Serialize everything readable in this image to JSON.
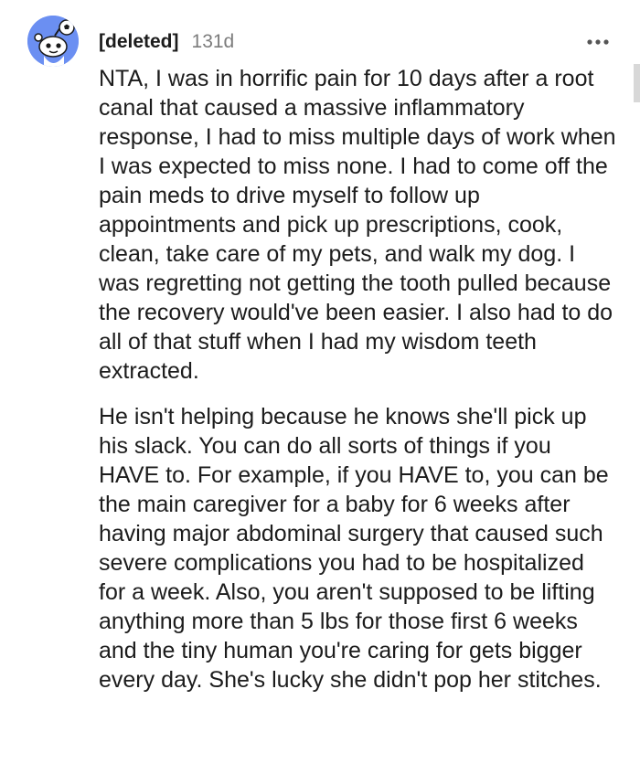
{
  "comment": {
    "author": "[deleted]",
    "age": "131d",
    "avatar_icon": "snoo-avatar-icon",
    "menu_icon": "overflow-menu-icon",
    "accent_color": "#6b8ff2",
    "paragraphs": [
      "NTA, I was in horrific pain for 10 days after a root canal that caused a massive inflammatory response, I had to miss multiple days of work when I was expected to miss none. I had to come off the pain meds to drive myself to follow up appointments and pick up prescriptions, cook, clean, take care of my pets, and walk my dog. I was regretting not getting the tooth pulled because the recovery would've been easier. I also had to do all of that stuff when I had my wisdom teeth extracted.",
      "He isn't helping because he knows she'll pick up his slack. You can do all sorts of things if you HAVE to. For example, if you HAVE to, you can be the main caregiver for a baby for 6 weeks after having major abdominal surgery that caused such severe complications you had to be hospitalized for a week. Also, you aren't supposed to be lifting anything more than 5 lbs for those first 6 weeks and the tiny human you're caring for gets bigger every day. She's lucky she didn't pop her stitches."
    ]
  }
}
